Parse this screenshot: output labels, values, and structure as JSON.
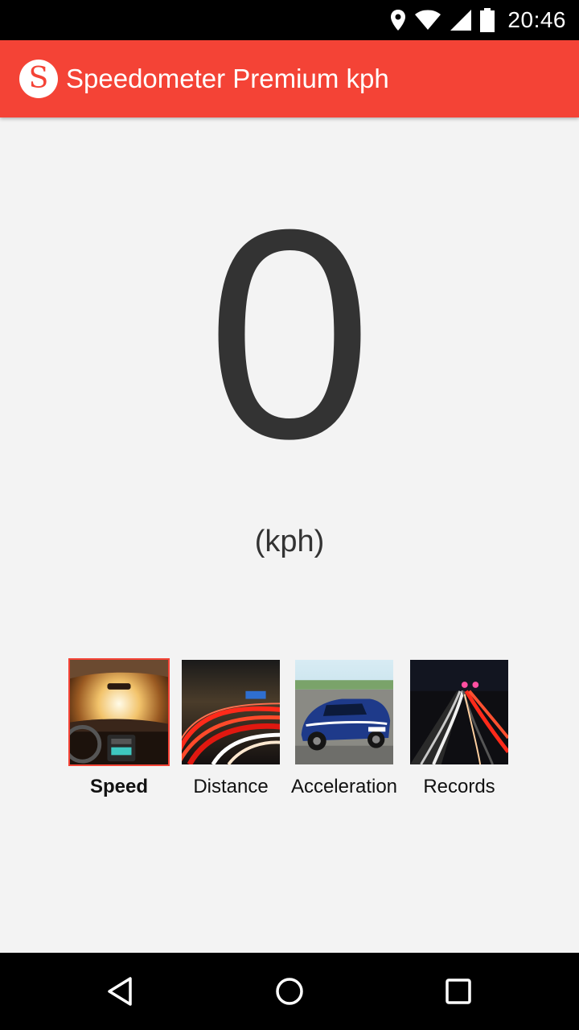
{
  "status_bar": {
    "time": "20:46",
    "icons": [
      "location-icon",
      "wifi-icon",
      "signal-icon",
      "battery-icon"
    ]
  },
  "app_bar": {
    "logo_letter": "S",
    "title": "Speedometer Premium kph",
    "color": "#f44336"
  },
  "speed": {
    "value": "0",
    "unit": "(kph)"
  },
  "modes": [
    {
      "label": "Speed",
      "selected": true,
      "icon": "car-interior-image"
    },
    {
      "label": "Distance",
      "selected": false,
      "icon": "light-trails-image"
    },
    {
      "label": "Acceleration",
      "selected": false,
      "icon": "race-car-image"
    },
    {
      "label": "Records",
      "selected": false,
      "icon": "highway-night-image"
    }
  ],
  "nav_bar": {
    "buttons": [
      "back-icon",
      "home-icon",
      "recents-icon"
    ]
  }
}
